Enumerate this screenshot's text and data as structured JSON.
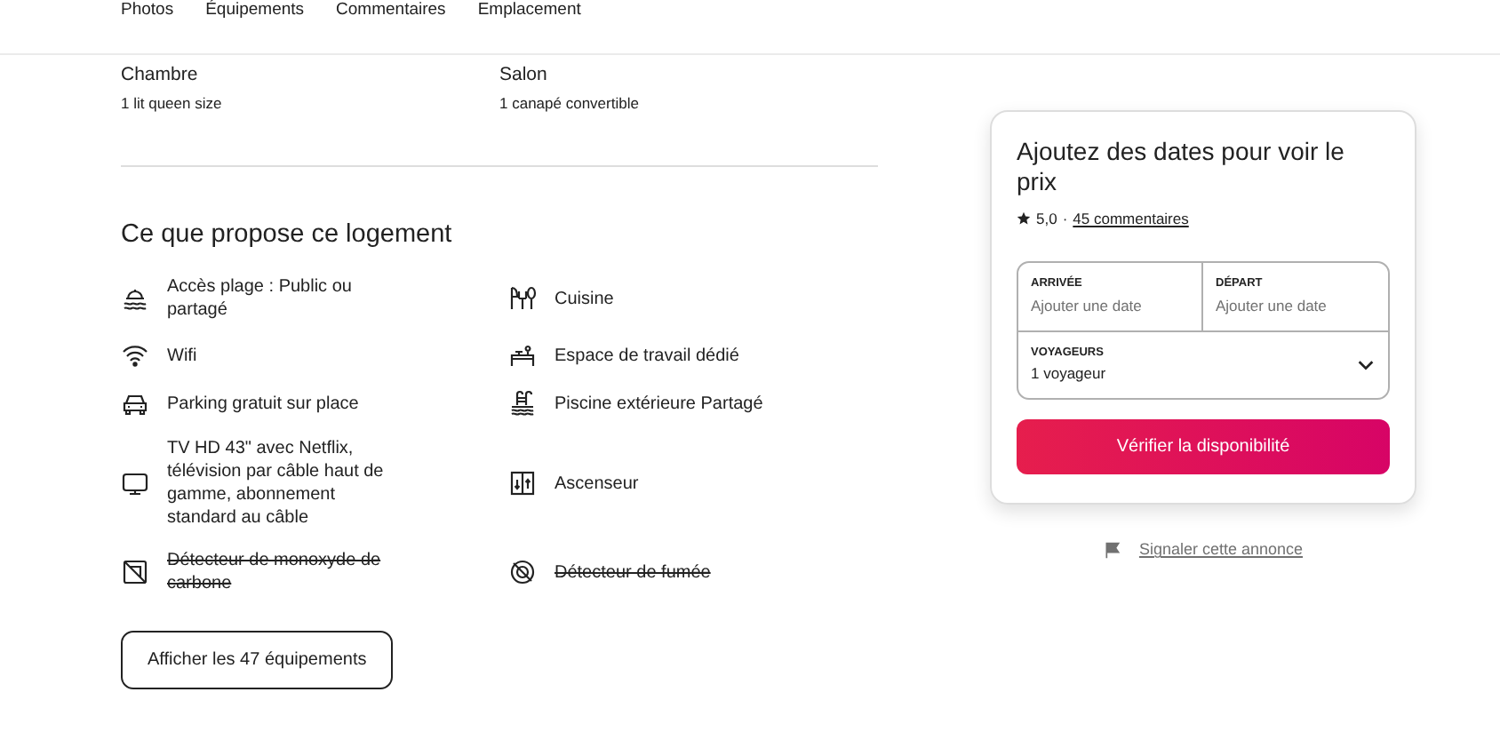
{
  "nav_tabs": [
    {
      "label": "Photos"
    },
    {
      "label": "Équipements"
    },
    {
      "label": "Commentaires"
    },
    {
      "label": "Emplacement"
    }
  ],
  "sleeping": [
    {
      "room": "Chambre",
      "beds": "1 lit queen size"
    },
    {
      "room": "Salon",
      "beds": "1 canapé convertible"
    }
  ],
  "amenities": {
    "title": "Ce que propose ce logement",
    "items": [
      {
        "kind": "beach",
        "label": "Accès plage : Public ou partagé",
        "available": true
      },
      {
        "kind": "kitchen",
        "label": "Cuisine",
        "available": true
      },
      {
        "kind": "wifi",
        "label": "Wifi",
        "available": true
      },
      {
        "kind": "workspace",
        "label": "Espace de travail dédié",
        "available": true
      },
      {
        "kind": "car",
        "label": "Parking gratuit sur place",
        "available": true
      },
      {
        "kind": "pool",
        "label": "Piscine extérieure Partagé",
        "available": true
      },
      {
        "kind": "tv",
        "label": "TV HD 43\" avec Netflix, télévision par câble haut de gamme, abonnement standard au câble",
        "available": true
      },
      {
        "kind": "elevator",
        "label": "Ascenseur",
        "available": true
      },
      {
        "kind": "co",
        "label": "Détecteur de monoxyde de carbone",
        "available": false
      },
      {
        "kind": "smoke",
        "label": "Détecteur de fumée",
        "available": false
      }
    ],
    "show_all": "Afficher les 47 équipements"
  },
  "booking": {
    "title": "Ajoutez des dates pour voir le prix",
    "rating": "5,0",
    "separator": "·",
    "reviews": "45 commentaires",
    "checkin": {
      "label": "ARRIVÉE",
      "placeholder": "Ajouter une date"
    },
    "checkout": {
      "label": "DÉPART",
      "placeholder": "Ajouter une date"
    },
    "guests": {
      "label": "VOYAGEURS",
      "value": "1 voyageur"
    },
    "button": "Vérifier la disponibilité"
  },
  "report": "Signaler cette annonce"
}
